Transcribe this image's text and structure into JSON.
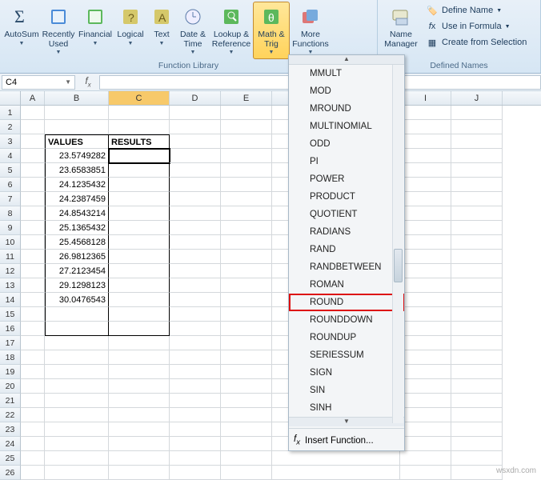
{
  "ribbon": {
    "library_group": "Function Library",
    "names_group": "Defined Names",
    "autosum": "AutoSum",
    "recently": "Recently Used",
    "financial": "Financial",
    "logical": "Logical",
    "text": "Text",
    "datetime": "Date & Time",
    "lookup": "Lookup & Reference",
    "mathtrig": "Math & Trig",
    "more": "More Functions",
    "name_manager": "Name Manager",
    "define_name": "Define Name",
    "use_in_formula": "Use in Formula",
    "create_selection": "Create from Selection"
  },
  "namebox": "C4",
  "columns": [
    "A",
    "B",
    "C",
    "D",
    "E",
    "",
    "",
    "",
    "I",
    "J"
  ],
  "headers": {
    "values": "VALUES",
    "results": "RESULTS"
  },
  "values": [
    "23.5749282",
    "23.6583851",
    "24.1235432",
    "24.2387459",
    "24.8543214",
    "25.1365432",
    "25.4568128",
    "26.9812365",
    "27.2123454",
    "29.1298123",
    "30.0476543"
  ],
  "menu": {
    "items": [
      "MMULT",
      "MOD",
      "MROUND",
      "MULTINOMIAL",
      "ODD",
      "PI",
      "POWER",
      "PRODUCT",
      "QUOTIENT",
      "RADIANS",
      "RAND",
      "RANDBETWEEN",
      "ROMAN",
      "ROUND",
      "ROUNDDOWN",
      "ROUNDUP",
      "SERIESSUM",
      "SIGN",
      "SIN",
      "SINH"
    ],
    "highlight": "ROUND",
    "insert_fn": "Insert Function..."
  },
  "watermark": "wsxdn.com"
}
